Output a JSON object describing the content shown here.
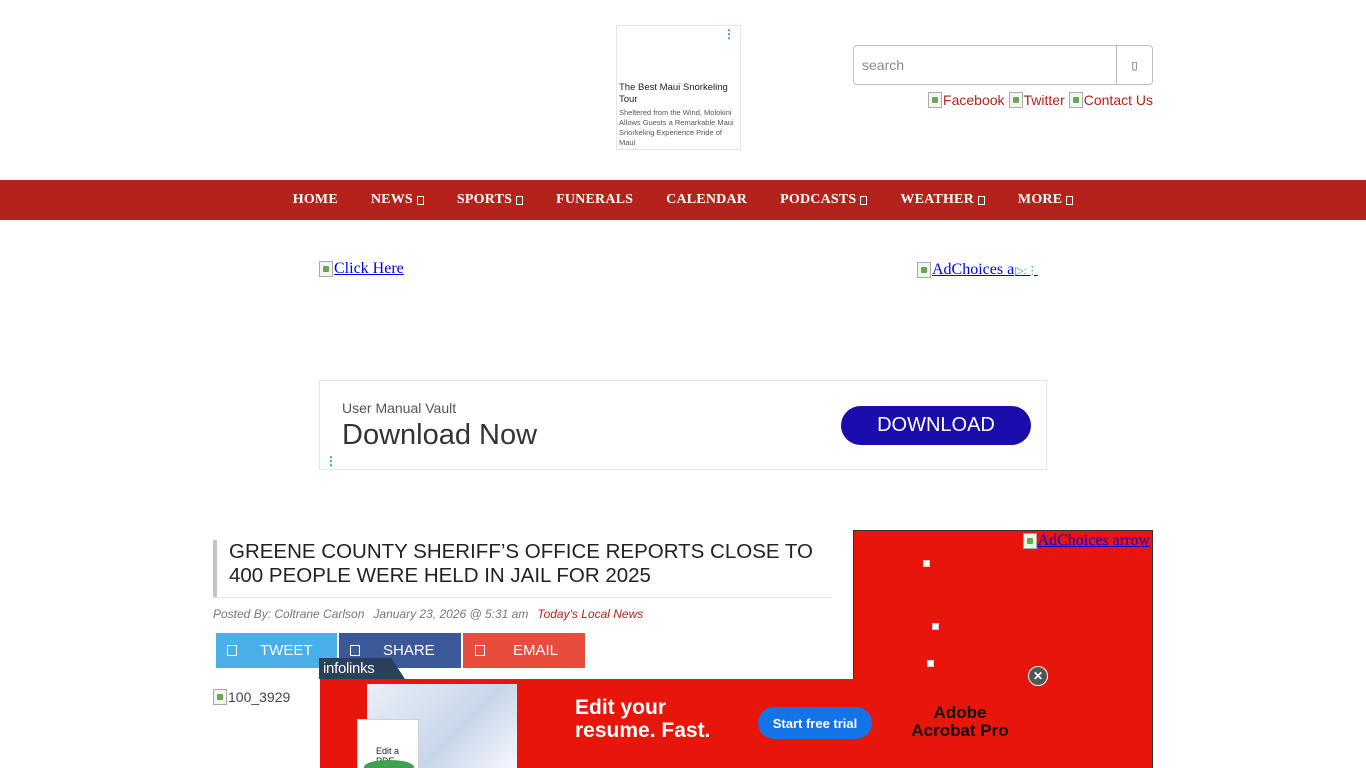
{
  "top_ad": {
    "title": "The Best Maui Snorkeling Tour",
    "description": "Sheltered from the Wind, Molokini Allows Guests a Remarkable Maui Snorkeling Experience Pride of Maui"
  },
  "search": {
    "placeholder": "search"
  },
  "social_links": [
    {
      "label": "Facebook"
    },
    {
      "label": "Twitter"
    },
    {
      "label": "Contact Us"
    }
  ],
  "nav": {
    "items": [
      {
        "label": "HOME",
        "dropdown": false
      },
      {
        "label": "NEWS",
        "dropdown": true
      },
      {
        "label": "SPORTS",
        "dropdown": true
      },
      {
        "label": "FUNERALS",
        "dropdown": false
      },
      {
        "label": "CALENDAR",
        "dropdown": false
      },
      {
        "label": "PODCASTS",
        "dropdown": true
      },
      {
        "label": "WEATHER",
        "dropdown": true
      },
      {
        "label": "MORE",
        "dropdown": true
      }
    ]
  },
  "ad_links": {
    "click_here": "Click Here",
    "adchoices": "AdChoices a",
    "adchoices_arrow": "AdChoices arrow"
  },
  "banner_ad": {
    "brand": "User Manual Vault",
    "headline": "Download Now",
    "button": "DOWNLOAD"
  },
  "article": {
    "title": "GREENE COUNTY SHERIFF’S OFFICE REPORTS CLOSE TO 400 PEOPLE WERE HELD IN JAIL FOR 2025",
    "author": "Posted By: Coltrane Carlson",
    "date": "January 23, 2026 @ 5:31 am",
    "category": "Today's Local News",
    "image_alt": "100_3929"
  },
  "share": {
    "tweet": "TWEET",
    "share": "SHARE",
    "email": "EMAIL"
  },
  "overlay_ad": {
    "tab": "infolinks",
    "doc_label": "Edit a PDF",
    "message_line1": "Edit your",
    "message_line2": "resume. Fast.",
    "cta": "Start free trial",
    "brand_line1": "Adobe",
    "brand_line2": "Acrobat Pro",
    "close": "✕"
  },
  "colors": {
    "brand_red": "#b5211b",
    "ad_red": "#e8150a",
    "tweet": "#4aaee8",
    "share": "#3b5998",
    "email": "#e74c3c"
  }
}
